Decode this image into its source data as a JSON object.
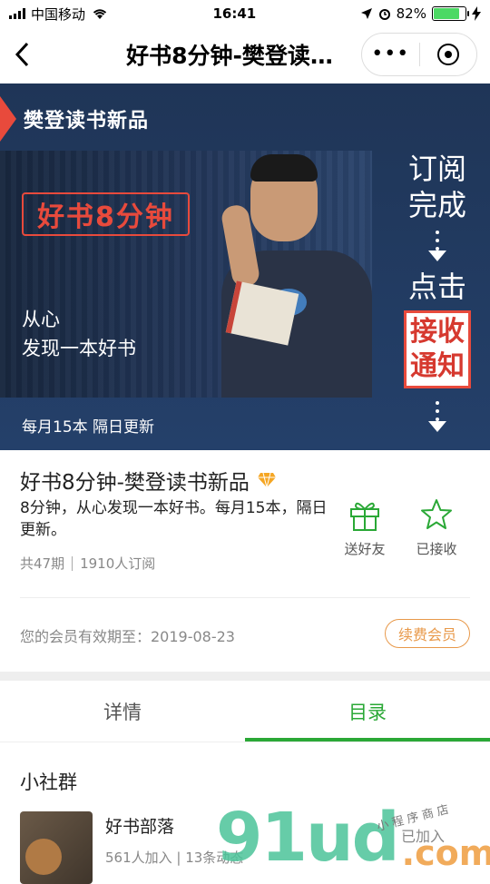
{
  "status_bar": {
    "carrier": "中国移动",
    "time": "16:41",
    "battery_percent": "82%",
    "battery_level": 0.82
  },
  "nav": {
    "title": "好书8分钟-樊登读…"
  },
  "banner": {
    "ribbon": "樊登读书新品",
    "logo": "好书8分钟",
    "slogan_line1": "从心",
    "slogan_line2": "发现一本好书",
    "frequency": "每月15本  隔日更新",
    "side_line1": "订阅",
    "side_line2": "完成",
    "side_line3": "点击",
    "notice_line1": "接收",
    "notice_line2": "通知"
  },
  "info": {
    "title": "好书8分钟-樊登读书新品",
    "description": "8分钟，从心发现一本好书。每月15本，隔日更新。",
    "episodes": "共47期",
    "subscribers": "1910人订阅",
    "gift_label": "送好友",
    "received_label": "已接收",
    "expiry": "您的会员有效期至：2019-08-23",
    "renew_label": "续费会员"
  },
  "tabs": [
    {
      "label": "详情",
      "active": false
    },
    {
      "label": "目录",
      "active": true
    }
  ],
  "community": {
    "section_title": "小社群",
    "group_name": "好书部落",
    "group_meta": "561人加入 | 13条动态",
    "joined_label": "已加入"
  },
  "watermark": {
    "big": "91ud",
    "com": ".com",
    "small": "小程序商店"
  },
  "colors": {
    "accent_green": "#2aa836",
    "banner_blue": "#1f3557",
    "red": "#e84a3c",
    "orange": "#e8994a"
  }
}
